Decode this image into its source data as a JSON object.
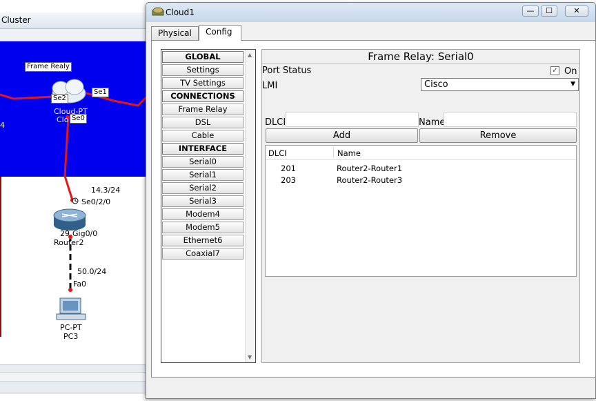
{
  "background": {
    "title": "Cluster",
    "topology": {
      "cloud_label": "Frame Realy",
      "cloud_ports": {
        "se2": "Se2",
        "se1": "Se1",
        "se0": "Se0"
      },
      "cloud_name_line1": "Cloud-PT",
      "cloud_name_line2": "Clo",
      "left_edge_digit": "4",
      "link_router_ip": "14.3/24",
      "router_port_serial": "Se0/2/0",
      "router_model_prefix": "29",
      "router_port_gig": "Gig0/0",
      "router_name": "Router2",
      "lan_ip": "50.0/24",
      "pc_port": "Fa0",
      "pc_model": "PC-PT",
      "pc_name": "PC3"
    }
  },
  "dialog": {
    "title": "Cloud1",
    "window_buttons": {
      "minimize": "—",
      "maximize": "☐",
      "close": "✕"
    },
    "tabs": [
      {
        "label": "Physical"
      },
      {
        "label": "Config"
      }
    ],
    "nav_items": [
      {
        "label": "GLOBAL",
        "header": true
      },
      {
        "label": "Settings"
      },
      {
        "label": "TV Settings"
      },
      {
        "label": "CONNECTIONS",
        "header": true
      },
      {
        "label": "Frame Relay"
      },
      {
        "label": "DSL"
      },
      {
        "label": "Cable"
      },
      {
        "label": "INTERFACE",
        "header": true
      },
      {
        "label": "Serial0"
      },
      {
        "label": "Serial1"
      },
      {
        "label": "Serial2"
      },
      {
        "label": "Serial3"
      },
      {
        "label": "Modem4"
      },
      {
        "label": "Modem5"
      },
      {
        "label": "Ethernet6"
      },
      {
        "label": "Coaxial7"
      }
    ],
    "panel": {
      "title": "Frame Relay: Serial0",
      "port_status_label": "Port Status",
      "port_status_on": true,
      "on_label": "On",
      "lmi_label": "LMI",
      "lmi_value": "Cisco",
      "dlci_label": "DLCI",
      "dlci_value": "",
      "name_label": "Name",
      "name_value": "",
      "add_label": "Add",
      "remove_label": "Remove",
      "table": {
        "headers": [
          "DLCI",
          "Name"
        ],
        "rows": [
          {
            "dlci": "201",
            "name": "Router2-Router1"
          },
          {
            "dlci": "203",
            "name": "Router2-Router3"
          }
        ]
      }
    }
  },
  "colors": {
    "cluster_bg": "#0000ee",
    "link_red": "#e01818",
    "lan_black": "#111111"
  }
}
